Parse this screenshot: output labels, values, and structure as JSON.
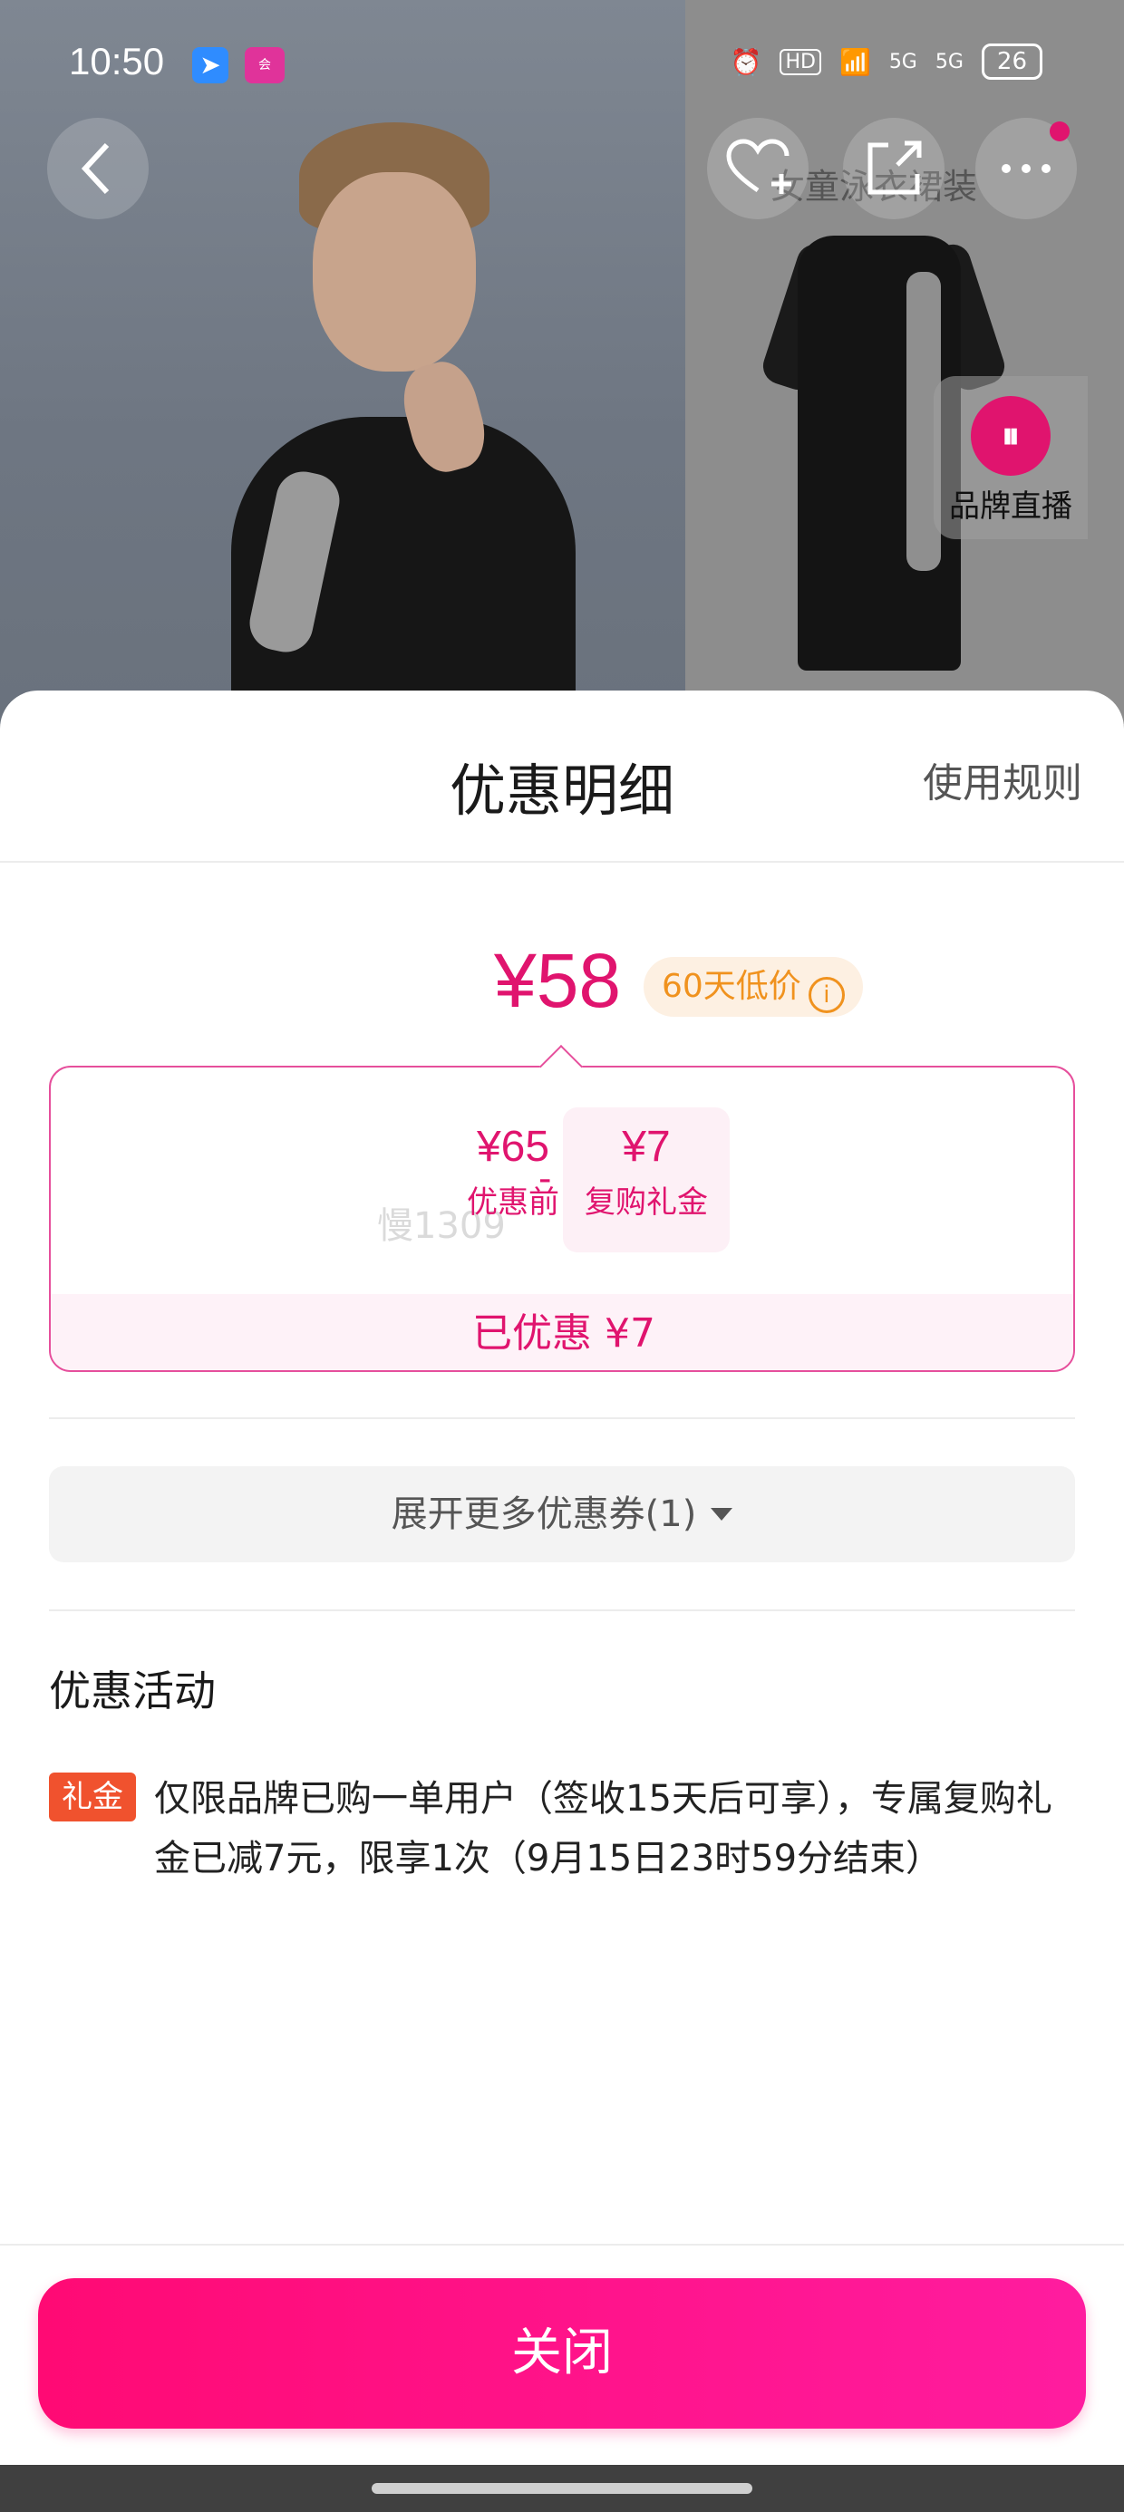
{
  "status_bar": {
    "time": "10:50",
    "app_icon_1": "arrow-app-icon",
    "app_icon_2": "vip-app-icon",
    "hd_label": "HD",
    "net_1": "5G",
    "net_2": "5G",
    "battery": "26"
  },
  "background": {
    "product_title": "女童泳衣裙装",
    "live_label": "品牌直播"
  },
  "sheet": {
    "title": "优惠明细",
    "rules_link": "使用规则",
    "price": "¥58",
    "price_badge": "60天低价",
    "breakdown": {
      "before_amount": "¥65",
      "before_label": "优惠前",
      "minus": "-",
      "gift_amount": "¥7",
      "gift_label": "复购礼金",
      "watermark": "慢1309",
      "saved_text": "已优惠 ¥7"
    },
    "expand_button": "展开更多优惠券(1)",
    "activities_title": "优惠活动",
    "activities": [
      {
        "tag": "礼金",
        "text": "仅限品牌已购一单用户（签收15天后可享），专属复购礼金已减7元，限享1次（9月15日23时59分结束）"
      }
    ],
    "close_button": "关闭"
  },
  "colors": {
    "accent": "#e0146e",
    "badge_orange": "#f0921e",
    "tag_red": "#f0522e"
  }
}
